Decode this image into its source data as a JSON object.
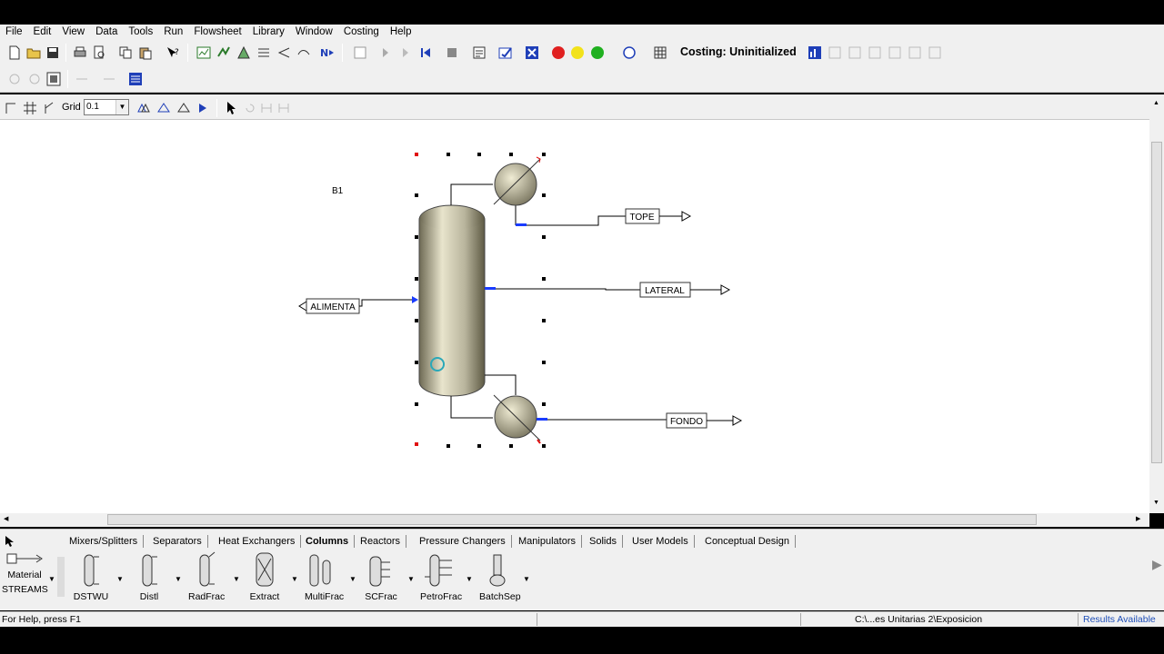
{
  "menu": [
    "File",
    "Edit",
    "View",
    "Data",
    "Tools",
    "Run",
    "Flowsheet",
    "Library",
    "Window",
    "Costing",
    "Help"
  ],
  "toolbar": {
    "costing_status": "Costing: Uninitialized",
    "grid_label": "Grid",
    "grid_value": "0.1"
  },
  "flowsheet": {
    "block_id": "B1",
    "streams": {
      "feed": "ALIMENTA",
      "top": "TOPE",
      "side": "LATERAL",
      "bottom": "FONDO"
    },
    "colors": {
      "column_body": "#b8b49c",
      "stream_line": "#000000",
      "port_marker": "#1a3cff",
      "handle_red": "#e01010"
    }
  },
  "palette": {
    "tabs": [
      "Mixers/Splitters",
      "Separators",
      "Heat Exchangers",
      "Columns",
      "Reactors",
      "Pressure Changers",
      "Manipulators",
      "Solids",
      "User Models",
      "Conceptual Design"
    ],
    "active_tab": "Columns",
    "streams_label_1": "Material",
    "streams_label_2": "STREAMS",
    "models": [
      "DSTWU",
      "Distl",
      "RadFrac",
      "Extract",
      "MultiFrac",
      "SCFrac",
      "PetroFrac",
      "BatchSep"
    ]
  },
  "status": {
    "help": "For Help, press F1",
    "path": "C:\\...es Unitarias 2\\Exposicion",
    "results": "Results Available",
    "results_color": "#1f4fb8"
  }
}
